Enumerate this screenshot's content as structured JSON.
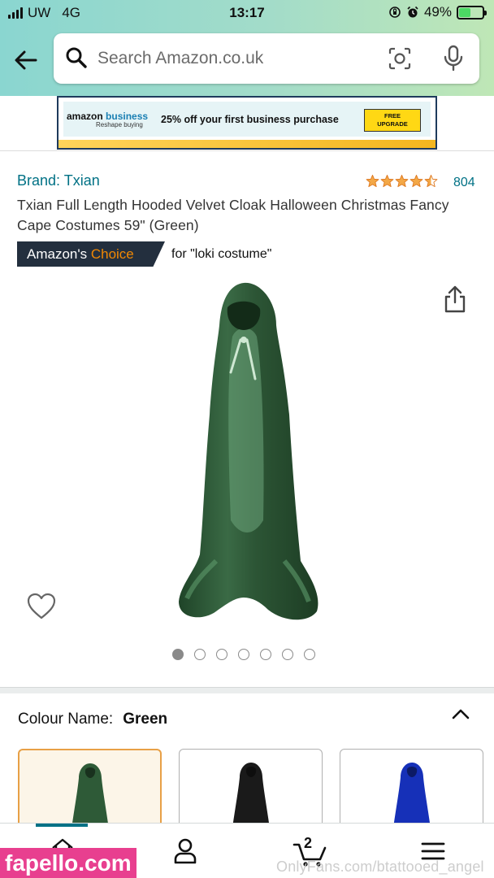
{
  "status_bar": {
    "carrier": "UW",
    "network": "4G",
    "time": "13:17",
    "battery": "49%",
    "battery_level": 0.49
  },
  "search": {
    "placeholder": "Search Amazon.co.uk"
  },
  "banner": {
    "logo_primary": "amazon",
    "logo_secondary": "business",
    "tagline": "Reshape buying",
    "message": "25% off your first business purchase",
    "cta_line1": "FREE",
    "cta_line2": "UPGRADE"
  },
  "product": {
    "brand": "Brand: Txian",
    "rating_stars": 4.5,
    "rating_count": "804",
    "title": "Txian Full Length Hooded Velvet Cloak Halloween Christmas Fancy Cape Costumes 59\" (Green)",
    "choice_prefix": "Amazon's ",
    "choice_word": "Choice",
    "choice_query": "for \"loki costume\"",
    "image_count": 7,
    "active_image": 0
  },
  "colour": {
    "label": "Colour Name:",
    "selected": "Green",
    "swatches": [
      {
        "name": "Green",
        "color": "#2e5a37"
      },
      {
        "name": "Black",
        "color": "#1a1a1a"
      },
      {
        "name": "Blue",
        "color": "#1630b8"
      }
    ]
  },
  "bottom_nav": {
    "cart_count": "2"
  },
  "watermarks": {
    "left": "fapello.com",
    "right": "OnlyFans.com/btattooed_angel"
  },
  "colors": {
    "accent_link": "#007185",
    "choice_badge": "#232f3e",
    "choice_orange": "#f08804",
    "star": "#f3a847"
  }
}
